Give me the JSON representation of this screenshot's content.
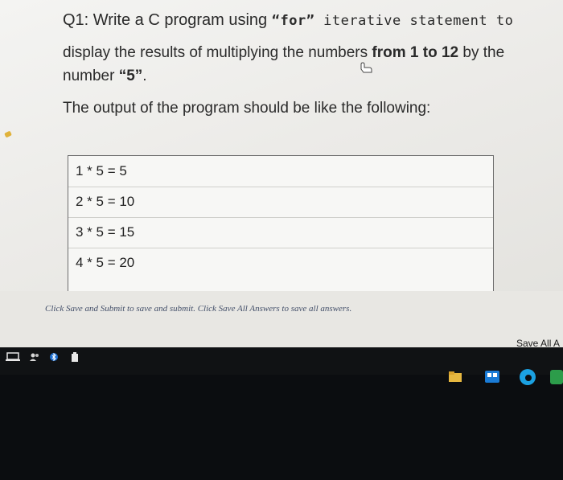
{
  "question": {
    "line1": {
      "prefix": "Q1: Write a C program using ",
      "keyword": "“for”",
      "suffix": " iterative statement to"
    },
    "line2": {
      "prefix": "display the results of multiplying the numbers ",
      "from": "from",
      "range": " 1 to 12",
      "by": " by the"
    },
    "line3": {
      "prefix": "number ",
      "number": "“5”",
      "suffix": "."
    },
    "intro": "The output of the program should be like the following:"
  },
  "answer_box": {
    "rows": [
      "1 * 5 = 5",
      "2 * 5 = 10",
      "3 * 5 = 15",
      "4 * 5 = 20",
      "."
    ]
  },
  "instructions": "Click Save and Submit to save and submit. Click Save All Answers to save all answers.",
  "save_all_label": "Save All A",
  "colors": {
    "page_bg": "#f0efec",
    "taskbar": "#101214",
    "accent_blue": "#1e6fd0"
  }
}
